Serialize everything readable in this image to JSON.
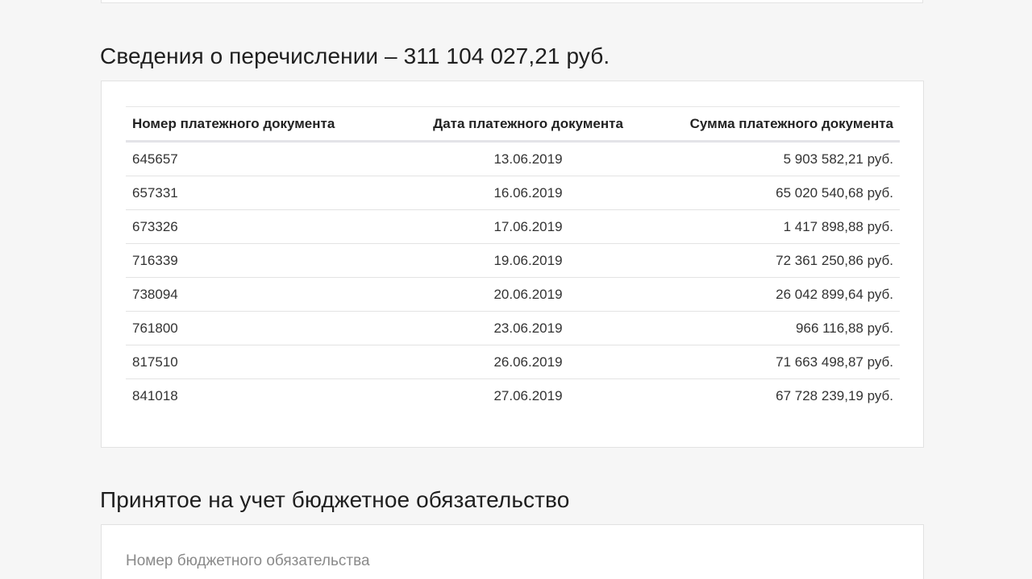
{
  "transfers": {
    "title": "Сведения о перечислении – 311 104 027,21 руб.",
    "columns": [
      "Номер платежного документа",
      "Дата платежного документа",
      "Сумма платежного документа"
    ],
    "rows": [
      {
        "number": "645657",
        "date": "13.06.2019",
        "amount": "5 903 582,21 руб."
      },
      {
        "number": "657331",
        "date": "16.06.2019",
        "amount": "65 020 540,68 руб."
      },
      {
        "number": "673326",
        "date": "17.06.2019",
        "amount": "1 417 898,88 руб."
      },
      {
        "number": "716339",
        "date": "19.06.2019",
        "amount": "72 361 250,86 руб."
      },
      {
        "number": "738094",
        "date": "20.06.2019",
        "amount": "26 042 899,64 руб."
      },
      {
        "number": "761800",
        "date": "23.06.2019",
        "amount": "966 116,88 руб."
      },
      {
        "number": "817510",
        "date": "26.06.2019",
        "amount": "71 663 498,87 руб."
      },
      {
        "number": "841018",
        "date": "27.06.2019",
        "amount": "67 728 239,19 руб."
      }
    ]
  },
  "obligation": {
    "title": "Принятое на учет бюджетное обязательство",
    "field_label": "Номер бюджетного обязательства"
  },
  "colors": {
    "page_background": "#f6f6f6",
    "card_background": "#ffffff",
    "border": "#e2e2e2",
    "label_gray": "#8a8a8a"
  }
}
